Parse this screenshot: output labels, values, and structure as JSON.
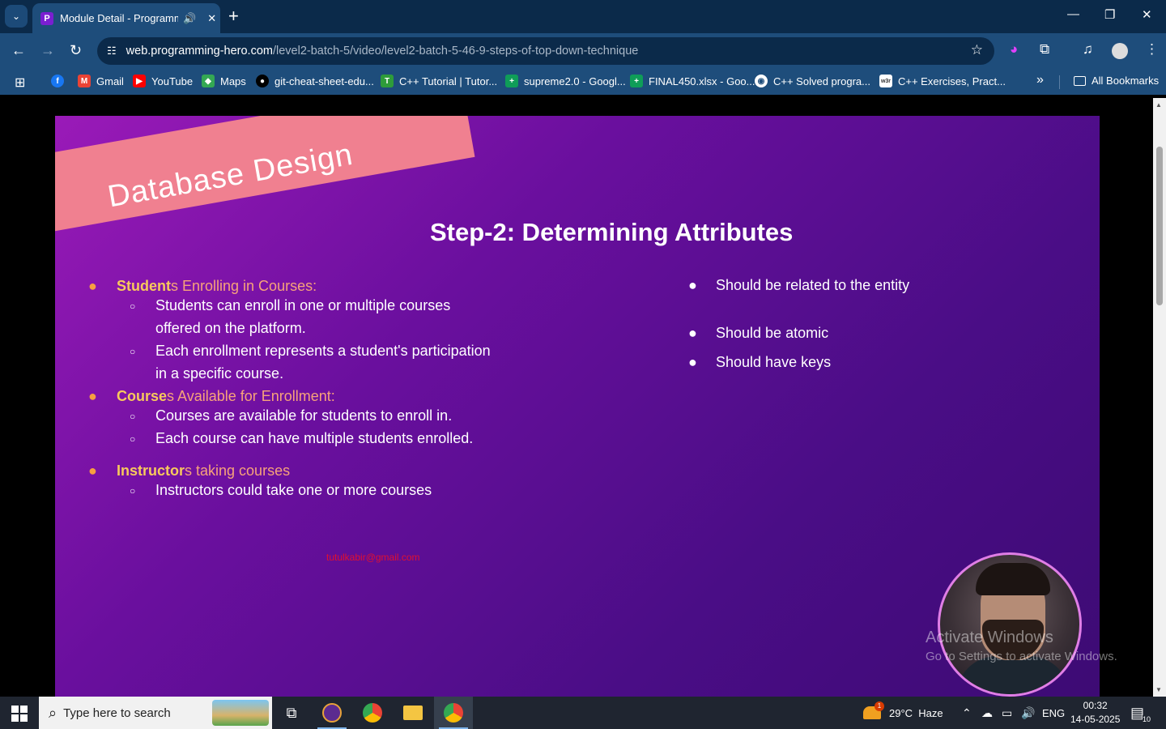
{
  "browser": {
    "tab": {
      "title": "Module Detail - Programming Hero",
      "favicon": "P",
      "audio_icon": "🔊",
      "close": "✕"
    },
    "new_tab": "+",
    "window_controls": {
      "minimize": "—",
      "restore": "❐",
      "close": "✕"
    },
    "url": {
      "host": "web.programming-hero.com",
      "path": "/level2-batch-5/video/level2-batch-5-46-9-steps-of-top-down-technique"
    },
    "bookmarks": [
      {
        "label": "",
        "icon": "facebook-icon",
        "color": "#1877f2",
        "glyph": "f"
      },
      {
        "label": "Gmail",
        "icon": "gmail-icon",
        "color": "#ea4335",
        "glyph": "M"
      },
      {
        "label": "YouTube",
        "icon": "youtube-icon",
        "color": "#ff0000",
        "glyph": "▶"
      },
      {
        "label": "Maps",
        "icon": "maps-icon",
        "color": "#34a853",
        "glyph": "◆"
      },
      {
        "label": "git-cheat-sheet-edu...",
        "icon": "github-icon",
        "color": "#24292e",
        "glyph": "●"
      },
      {
        "label": "C++ Tutorial | Tutor...",
        "icon": "tutorial-icon",
        "color": "#2e9c3a",
        "glyph": "T"
      },
      {
        "label": "supreme2.0 - Googl...",
        "icon": "sheets-icon",
        "color": "#0f9d58",
        "glyph": "+"
      },
      {
        "label": "FINAL450.xlsx - Goo...",
        "icon": "sheets-icon",
        "color": "#0f9d58",
        "glyph": "+"
      },
      {
        "label": "C++ Solved progra...",
        "icon": "globe-icon",
        "color": "#5f6368",
        "glyph": "◉"
      },
      {
        "label": "C++ Exercises, Pract...",
        "icon": "w3r-icon",
        "color": "#ffffff",
        "glyph": "w3r"
      }
    ],
    "all_bookmarks": "All Bookmarks",
    "overflow": "»"
  },
  "slide": {
    "banner": "Database Design",
    "title": "Step-2: Determining Attributes",
    "sections": [
      {
        "highlight": "Student",
        "rest": "s Enrolling in Courses:",
        "items": [
          "Students can enroll in one or multiple courses offered on the platform.",
          "Each enrollment represents a student's participation in a specific course."
        ]
      },
      {
        "highlight": "Course",
        "rest": "s Available for Enrollment:",
        "items": [
          "Courses are available for students to enroll in.",
          "Each course can have multiple students enrolled."
        ]
      },
      {
        "highlight": "Instructor",
        "rest": "s taking courses",
        "items": [
          "Instructors could take one or more courses"
        ]
      }
    ],
    "right_points": [
      "Should be related to the entity",
      "Should be atomic",
      "Should have keys"
    ],
    "watermark_email": "tutulkabir@gmail.com"
  },
  "activation": {
    "title": "Activate Windows",
    "subtitle": "Go to Settings to activate Windows."
  },
  "taskbar": {
    "search_placeholder": "Type here to search",
    "weather": {
      "temp": "29°C",
      "condition": "Haze",
      "badge": "1"
    },
    "language": "ENG",
    "time": "00:32",
    "date": "14-05-2025",
    "notifications": "10"
  }
}
